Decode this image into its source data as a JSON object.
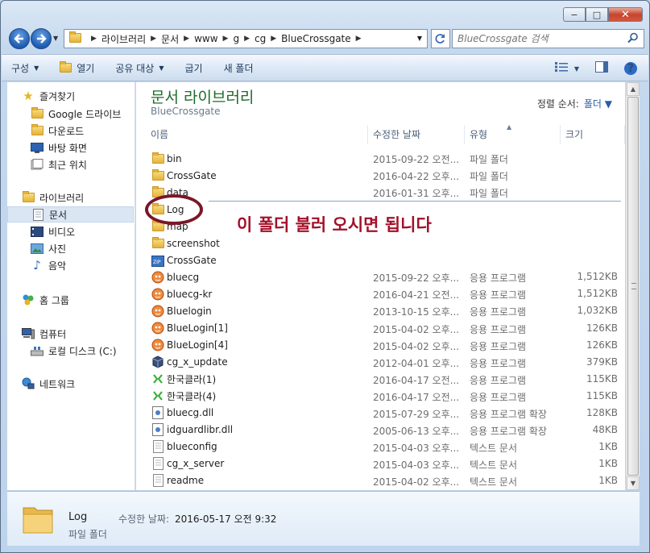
{
  "window": {
    "caption": {
      "minimize": "−",
      "maximize": "□",
      "close": "✕"
    }
  },
  "address": {
    "crumbs": [
      "라이브러리",
      "문서",
      "www",
      "g",
      "cg",
      "BlueCrossgate"
    ],
    "search_placeholder": "BlueCrossgate 검색"
  },
  "toolbar": {
    "organize": "구성",
    "open": "열기",
    "share": "공유 대상",
    "burn": "굽기",
    "new_folder": "새 폴더"
  },
  "navpane": {
    "favorites": "즐겨찾기",
    "google_drive": "Google 드라이브",
    "downloads": "다운로드",
    "desktop": "바탕 화면",
    "recent": "최근 위치",
    "libraries": "라이브러리",
    "documents": "문서",
    "videos": "비디오",
    "pictures": "사진",
    "music": "음악",
    "homegroup": "홈 그룹",
    "computer": "컴퓨터",
    "local_disk": "로컬 디스크 (C:)",
    "network": "네트워크"
  },
  "library": {
    "title": "문서 라이브러리",
    "subtitle": "BlueCrossgate",
    "sort_label": "정렬 순서:",
    "sort_value": "폴더"
  },
  "columns": {
    "name": "이름",
    "date": "수정한 날짜",
    "type": "유형",
    "size": "크기"
  },
  "files": [
    {
      "name": "bin",
      "date": "2015-09-22 오전...",
      "type": "파일 폴더",
      "size": "",
      "icon": "folder-icon"
    },
    {
      "name": "CrossGate",
      "date": "2016-04-22 오후...",
      "type": "파일 폴더",
      "size": "",
      "icon": "folder-icon"
    },
    {
      "name": "data",
      "date": "2016-01-31 오후...",
      "type": "파일 폴더",
      "size": "",
      "icon": "folder-icon"
    },
    {
      "name": "Log",
      "date": "",
      "type": "",
      "size": "",
      "icon": "folder-icon"
    },
    {
      "name": "map",
      "date": "",
      "type": "",
      "size": "",
      "icon": "folder-icon"
    },
    {
      "name": "screenshot",
      "date": "",
      "type": "",
      "size": "",
      "icon": "folder-icon"
    },
    {
      "name": "CrossGate",
      "date": "",
      "type": "",
      "size": "",
      "icon": "zip-folder-icon"
    },
    {
      "name": "bluecg",
      "date": "2015-09-22 오후...",
      "type": "응용 프로그램",
      "size": "1,512KB",
      "icon": "app-icon"
    },
    {
      "name": "bluecg-kr",
      "date": "2016-04-21 오전...",
      "type": "응용 프로그램",
      "size": "1,512KB",
      "icon": "app-icon"
    },
    {
      "name": "Bluelogin",
      "date": "2013-10-15 오후...",
      "type": "응용 프로그램",
      "size": "1,032KB",
      "icon": "app-icon"
    },
    {
      "name": "BlueLogin[1]",
      "date": "2015-04-02 오후...",
      "type": "응용 프로그램",
      "size": "126KB",
      "icon": "app-icon"
    },
    {
      "name": "BlueLogin[4]",
      "date": "2015-04-02 오후...",
      "type": "응용 프로그램",
      "size": "126KB",
      "icon": "app-icon"
    },
    {
      "name": "cg_x_update",
      "date": "2012-04-01 오후...",
      "type": "응용 프로그램",
      "size": "379KB",
      "icon": "updater-icon"
    },
    {
      "name": "한국클라(1)",
      "date": "2016-04-17 오전...",
      "type": "응용 프로그램",
      "size": "115KB",
      "icon": "launcher-icon"
    },
    {
      "name": "한국클라(4)",
      "date": "2016-04-17 오전...",
      "type": "응용 프로그램",
      "size": "115KB",
      "icon": "launcher-icon"
    },
    {
      "name": "bluecg.dll",
      "date": "2015-07-29 오후...",
      "type": "응용 프로그램 확장",
      "size": "128KB",
      "icon": "dll-icon"
    },
    {
      "name": "idguardlibr.dll",
      "date": "2005-06-13 오후...",
      "type": "응용 프로그램 확장",
      "size": "48KB",
      "icon": "dll-icon"
    },
    {
      "name": "blueconfig",
      "date": "2015-04-03 오후...",
      "type": "텍스트 문서",
      "size": "1KB",
      "icon": "text-file-icon"
    },
    {
      "name": "cg_x_server",
      "date": "2015-04-03 오후...",
      "type": "텍스트 문서",
      "size": "1KB",
      "icon": "text-file-icon"
    },
    {
      "name": "readme",
      "date": "2015-04-02 오후...",
      "type": "텍스트 문서",
      "size": "1KB",
      "icon": "text-file-icon"
    }
  ],
  "annotation": {
    "text": "이 폴더 불러 오시면 됩니다",
    "color": "#a3102a"
  },
  "details": {
    "name": "Log",
    "modified_label": "수정한 날짜:",
    "modified_value": "2016-05-17 오전 9:32",
    "type": "파일 폴더"
  }
}
